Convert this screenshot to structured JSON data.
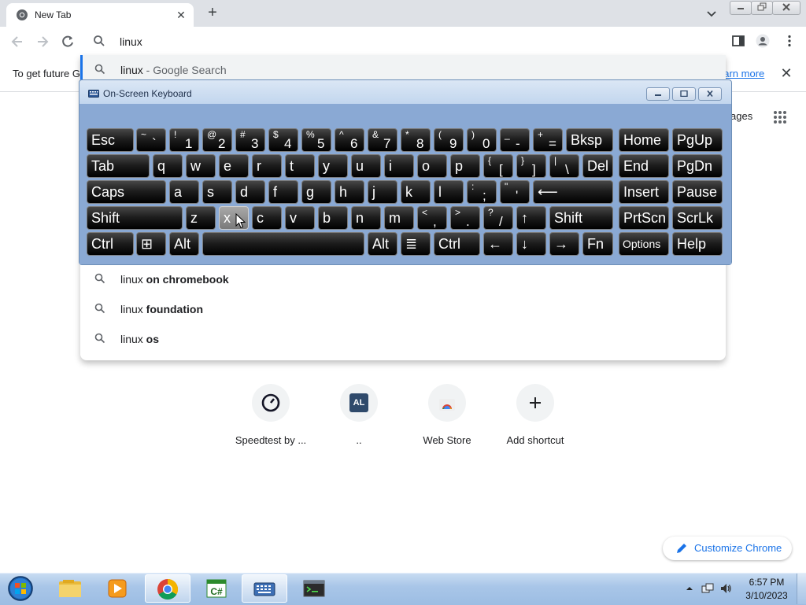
{
  "browser": {
    "tab_title": "New Tab",
    "omnibox_value": "linux",
    "infobar_text": "To get future G",
    "infobar_link": "earn more",
    "apps_label": "ages"
  },
  "suggestions": [
    {
      "prefix": "linux",
      "bold": "",
      "suffix": " - Google Search"
    },
    {
      "prefix": "linux",
      "bold": " on chromebook",
      "suffix": ""
    },
    {
      "prefix": "linux",
      "bold": " foundation",
      "suffix": ""
    },
    {
      "prefix": "linux",
      "bold": " os",
      "suffix": ""
    }
  ],
  "shortcuts": [
    {
      "label": "Speedtest by ...",
      "icon": "speedtest-icon"
    },
    {
      "label": "..",
      "icon": "al-icon",
      "icon_text": "AL"
    },
    {
      "label": "Web Store",
      "icon": "webstore-icon"
    },
    {
      "label": "Add shortcut",
      "icon": "plus-icon"
    }
  ],
  "customize_label": "Customize Chrome",
  "osk": {
    "title": "On-Screen Keyboard",
    "rows": [
      [
        {
          "label": "Esc"
        },
        {
          "top": "~",
          "bot": "`"
        },
        {
          "top": "!",
          "bot": "1"
        },
        {
          "top": "@",
          "bot": "2"
        },
        {
          "top": "#",
          "bot": "3"
        },
        {
          "top": "$",
          "bot": "4"
        },
        {
          "top": "%",
          "bot": "5"
        },
        {
          "top": "^",
          "bot": "6"
        },
        {
          "top": "&",
          "bot": "7"
        },
        {
          "top": "*",
          "bot": "8"
        },
        {
          "top": "(",
          "bot": "9"
        },
        {
          "top": ")",
          "bot": "0"
        },
        {
          "top": "_",
          "bot": "-"
        },
        {
          "top": "+",
          "bot": "="
        },
        {
          "label": "Bksp"
        },
        {
          "label": "Home"
        },
        {
          "label": "PgUp"
        }
      ],
      [
        {
          "label": "Tab"
        },
        {
          "label": "q"
        },
        {
          "label": "w"
        },
        {
          "label": "e"
        },
        {
          "label": "r"
        },
        {
          "label": "t"
        },
        {
          "label": "y"
        },
        {
          "label": "u"
        },
        {
          "label": "i"
        },
        {
          "label": "o"
        },
        {
          "label": "p"
        },
        {
          "top": "{",
          "bot": "["
        },
        {
          "top": "}",
          "bot": "]"
        },
        {
          "top": "|",
          "bot": "\\"
        },
        {
          "label": "Del"
        },
        {
          "label": "End"
        },
        {
          "label": "PgDn"
        }
      ],
      [
        {
          "label": "Caps"
        },
        {
          "label": "a"
        },
        {
          "label": "s"
        },
        {
          "label": "d"
        },
        {
          "label": "f"
        },
        {
          "label": "g"
        },
        {
          "label": "h"
        },
        {
          "label": "j"
        },
        {
          "label": "k"
        },
        {
          "label": "l"
        },
        {
          "top": ":",
          "bot": ";"
        },
        {
          "top": "\"",
          "bot": "'"
        },
        {
          "label": "⟵"
        },
        {
          "label": "Insert"
        },
        {
          "label": "Pause"
        }
      ],
      [
        {
          "label": "Shift"
        },
        {
          "label": "z"
        },
        {
          "label": "x"
        },
        {
          "label": "c"
        },
        {
          "label": "v"
        },
        {
          "label": "b"
        },
        {
          "label": "n"
        },
        {
          "label": "m"
        },
        {
          "top": "<",
          "bot": ","
        },
        {
          "top": ">",
          "bot": "."
        },
        {
          "top": "?",
          "bot": "/"
        },
        {
          "label": "↑"
        },
        {
          "label": "Shift"
        },
        {
          "label": "PrtScn"
        },
        {
          "label": "ScrLk"
        }
      ],
      [
        {
          "label": "Ctrl"
        },
        {
          "label": "⊞"
        },
        {
          "label": "Alt"
        },
        {
          "label": ""
        },
        {
          "label": "Alt"
        },
        {
          "label": "≣"
        },
        {
          "label": "Ctrl"
        },
        {
          "label": "←"
        },
        {
          "label": "↓"
        },
        {
          "label": "→"
        },
        {
          "label": "Fn"
        },
        {
          "label": "Options"
        },
        {
          "label": "Help"
        }
      ]
    ]
  },
  "taskbar": {
    "clock_time": "6:57 PM",
    "clock_date": "3/10/2023",
    "apps": [
      "explorer-icon",
      "media-player-icon",
      "chrome-icon",
      "csharp-icon",
      "osk-icon",
      "terminal-icon"
    ],
    "active_app": "chrome-icon"
  },
  "colors": {
    "accent": "#1a73e8",
    "taskbar": "#a9c6e8",
    "osk_frame": "#8aa9d4"
  }
}
